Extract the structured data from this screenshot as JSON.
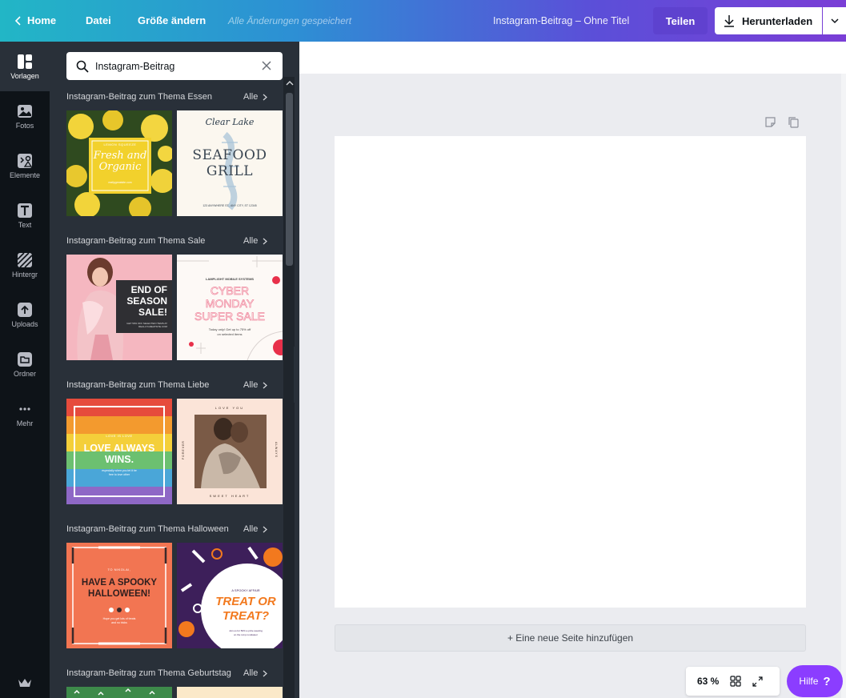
{
  "topbar": {
    "home_label": "Home",
    "file_label": "Datei",
    "resize_label": "Größe ändern",
    "saved_status": "Alle Änderungen gespeichert",
    "document_title": "Instagram-Beitrag – Ohne Titel",
    "share_label": "Teilen",
    "download_label": "Herunterladen"
  },
  "rail": {
    "items": [
      {
        "label": "Vorlagen",
        "icon": "templates-icon"
      },
      {
        "label": "Fotos",
        "icon": "photos-icon"
      },
      {
        "label": "Elemente",
        "icon": "elements-icon"
      },
      {
        "label": "Text",
        "icon": "text-icon"
      },
      {
        "label": "Hintergr",
        "icon": "background-icon"
      },
      {
        "label": "Uploads",
        "icon": "upload-icon"
      },
      {
        "label": "Ordner",
        "icon": "folder-icon"
      },
      {
        "label": "Mehr",
        "icon": "more-icon"
      }
    ]
  },
  "search": {
    "value": "Instagram-Beitrag"
  },
  "sections": [
    {
      "title": "Instagram-Beitrag zum Thema Essen",
      "all_label": "Alle"
    },
    {
      "title": "Instagram-Beitrag zum Thema Sale",
      "all_label": "Alle"
    },
    {
      "title": "Instagram-Beitrag zum Thema Liebe",
      "all_label": "Alle"
    },
    {
      "title": "Instagram-Beitrag zum Thema Halloween",
      "all_label": "Alle"
    },
    {
      "title": "Instagram-Beitrag zum Thema Geburtstag",
      "all_label": "Alle"
    }
  ],
  "templates": {
    "lemon": {
      "top": "LEMON SQUEEZE",
      "main": "Fresh and Organic",
      "sub": "reallygreatsite.com"
    },
    "seafood": {
      "script": "Clear Lake",
      "line1": "SEAFOOD",
      "line2": "GRILL",
      "address": "123 ANYWHERE ST., ANY CITY, ST 12345"
    },
    "season": {
      "line1": "END OF",
      "line2": "SEASON",
      "line3": "SALE!",
      "small": "GET 50% OFF SELECTED ITEMS AT REALLYGREATSITE.COM"
    },
    "cyber": {
      "top": "LAMPLIGHT MOBILE SYSTEMS",
      "line1": "CYBER",
      "line2": "MONDAY",
      "line3": "SUPER SALE",
      "small1": "Today only! Get up to 75% off",
      "small2": "on selected items"
    },
    "love": {
      "small": "LOVE IS LOVE",
      "line1": "LOVE ALWAYS",
      "line2": "WINS.",
      "caption1": "especially when you let it be",
      "caption2": "free to love other"
    },
    "couple": {
      "top": "LOVE YOU",
      "left": "FOREVER",
      "right": "ALWAYS",
      "bottom": "SWEET HEART"
    },
    "spooky": {
      "top": "TO NIKOLAI,",
      "line1": "HAVE A SPOOKY",
      "line2": "HALLOWEEN!",
      "small1": "Hope you get lots of treats",
      "small2": "and no tricks"
    },
    "treat": {
      "small": "A SPOOKY AFFAIR",
      "line1": "TREAT OR",
      "line2": "TREAT?",
      "tiny1": "Join us for 50% a prize wearing",
      "tiny2": "on the Limp nondateor"
    }
  },
  "canvas": {
    "add_page_label": "+ Eine neue Seite hinzufügen"
  },
  "zoom": {
    "level": "63 %"
  },
  "help": {
    "label": "Hilfe",
    "mark": "?"
  }
}
